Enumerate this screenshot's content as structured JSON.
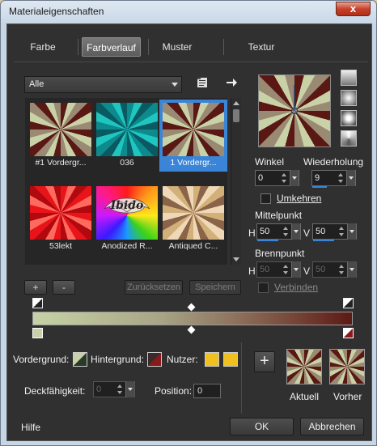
{
  "window": {
    "title": "Materialeigenschaften",
    "close_label": "x"
  },
  "tabs": [
    {
      "label": "Farbe",
      "active": false
    },
    {
      "label": "Farbverlauf",
      "active": true
    },
    {
      "label": "Muster",
      "active": false
    },
    {
      "label": "Textur",
      "active": false
    }
  ],
  "category_select": {
    "value": "Alle"
  },
  "gallery": {
    "items": [
      {
        "caption": "#1 Vordergr...",
        "c1": "#5a1814",
        "c2": "#c8d2a6",
        "c3": "#9a8a74",
        "selected": false
      },
      {
        "caption": "036",
        "c1": "#0c8a8c",
        "c2": "#1fc6c0",
        "c3": "#0a5a64",
        "selected": false
      },
      {
        "caption": "1 Vordergr...",
        "c1": "#5a1814",
        "c2": "#c8d2a6",
        "c3": "#9a8a74",
        "selected": true
      },
      {
        "caption": "53lekt",
        "c1": "#e8141a",
        "c2": "#ff6a5e",
        "c3": "#b00a10",
        "selected": false
      },
      {
        "caption": "Anodized R...",
        "c1": "#ff3a1a",
        "c2": "#ffd21a",
        "c3": "#2a4aff",
        "selected": false
      },
      {
        "caption": "Antiqued C...",
        "c1": "#d2b07a",
        "c2": "#8a6448",
        "c3": "#efd8b8",
        "selected": false
      }
    ],
    "watermark": "Ibido"
  },
  "buttons": {
    "add": "+",
    "remove": "-",
    "reset": "Zurücksetzen",
    "save": "Speichern"
  },
  "angle": {
    "label": "Winkel",
    "value": "0"
  },
  "repeat": {
    "label": "Wiederholung",
    "value": "9"
  },
  "invert": {
    "label": "Umkehren",
    "checked": false
  },
  "center": {
    "label": "Mittelpunkt",
    "h_label": "H",
    "h_value": "50",
    "v_label": "V",
    "v_value": "50"
  },
  "focus": {
    "label": "Brennpunkt",
    "h_label": "H",
    "h_value": "50",
    "v_label": "V",
    "v_value": "50"
  },
  "link": {
    "label": "Verbinden",
    "checked": false
  },
  "foreground": {
    "label": "Vordergrund:"
  },
  "background": {
    "label": "Hintergrund:"
  },
  "user": {
    "label": "Nutzer:",
    "color": "#f0c020"
  },
  "opacity": {
    "label": "Deckfähigkeit:",
    "value": "0"
  },
  "position": {
    "label": "Position:",
    "value": "0"
  },
  "current": {
    "label": "Aktuell"
  },
  "previous": {
    "label": "Vorher"
  },
  "footer": {
    "help": "Hilfe",
    "ok": "OK",
    "cancel": "Abbrechen"
  },
  "colors": {
    "accent": "#3a85d8",
    "gradient_start": "#c7d3a6",
    "gradient_end": "#5c1a14"
  }
}
